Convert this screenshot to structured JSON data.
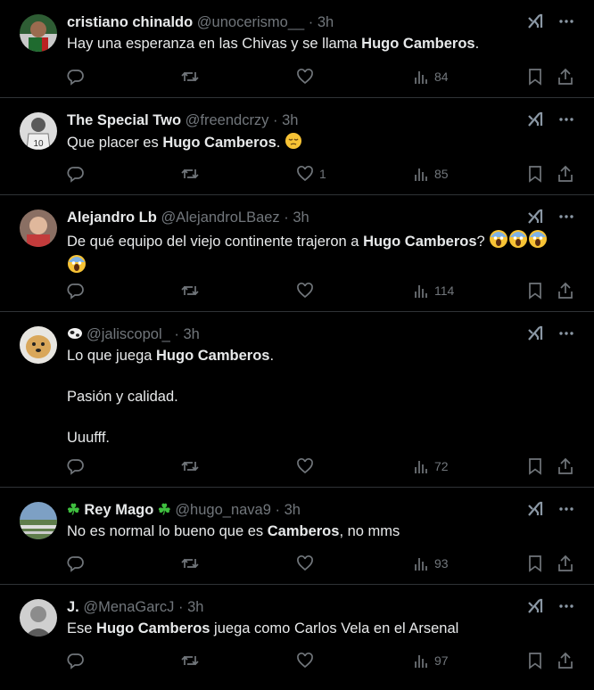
{
  "tweets": [
    {
      "name": "cristiano chinaldo",
      "handle": "@unocerismo__",
      "time": "3h",
      "text_pre": "Hay una esperanza en las Chivas y se llama ",
      "text_bold": "Hugo Camberos",
      "text_post": ".",
      "likes": "",
      "views": "84"
    },
    {
      "name": "The Special Two",
      "handle": "@freendcrzy",
      "time": "3h",
      "text_pre": "Que placer es ",
      "text_bold": "Hugo Camberos",
      "text_post": ".",
      "likes": "1",
      "views": "85"
    },
    {
      "name": "Alejandro Lb",
      "handle": "@AlejandroLBaez",
      "time": "3h",
      "text_pre": "De qué equipo del viejo continente trajeron a ",
      "text_bold": "Hugo Camberos",
      "text_post": "?",
      "likes": "",
      "views": "114"
    },
    {
      "name": "",
      "handle": "@jaliscopol_",
      "time": "3h",
      "text_pre": "Lo que juega ",
      "text_bold": "Hugo Camberos",
      "text_post": ".",
      "line2": "Pasión y calidad.",
      "line3": "Uuufff.",
      "likes": "",
      "views": "72"
    },
    {
      "name": "Rey Mago",
      "handle": "@hugo_nava9",
      "time": "3h",
      "text_pre": "No es normal lo bueno que es ",
      "text_bold": "Camberos",
      "text_post": ", no mms",
      "likes": "",
      "views": "93"
    },
    {
      "name": "J.",
      "handle": "@MenaGarcJ",
      "time": "3h",
      "text_pre": "Ese ",
      "text_bold": "Hugo Camberos",
      "text_post": " juega como Carlos Vela en el Arsenal",
      "likes": "",
      "views": "97"
    }
  ],
  "separator": "·",
  "icons": [
    "grok-icon",
    "more-icon",
    "reply-icon",
    "repost-icon",
    "like-icon",
    "views-icon",
    "bookmark-icon",
    "share-icon"
  ],
  "colors": {
    "background": "#000000",
    "text": "#e7e9ea",
    "muted": "#71767b",
    "divider": "#2f3336"
  }
}
